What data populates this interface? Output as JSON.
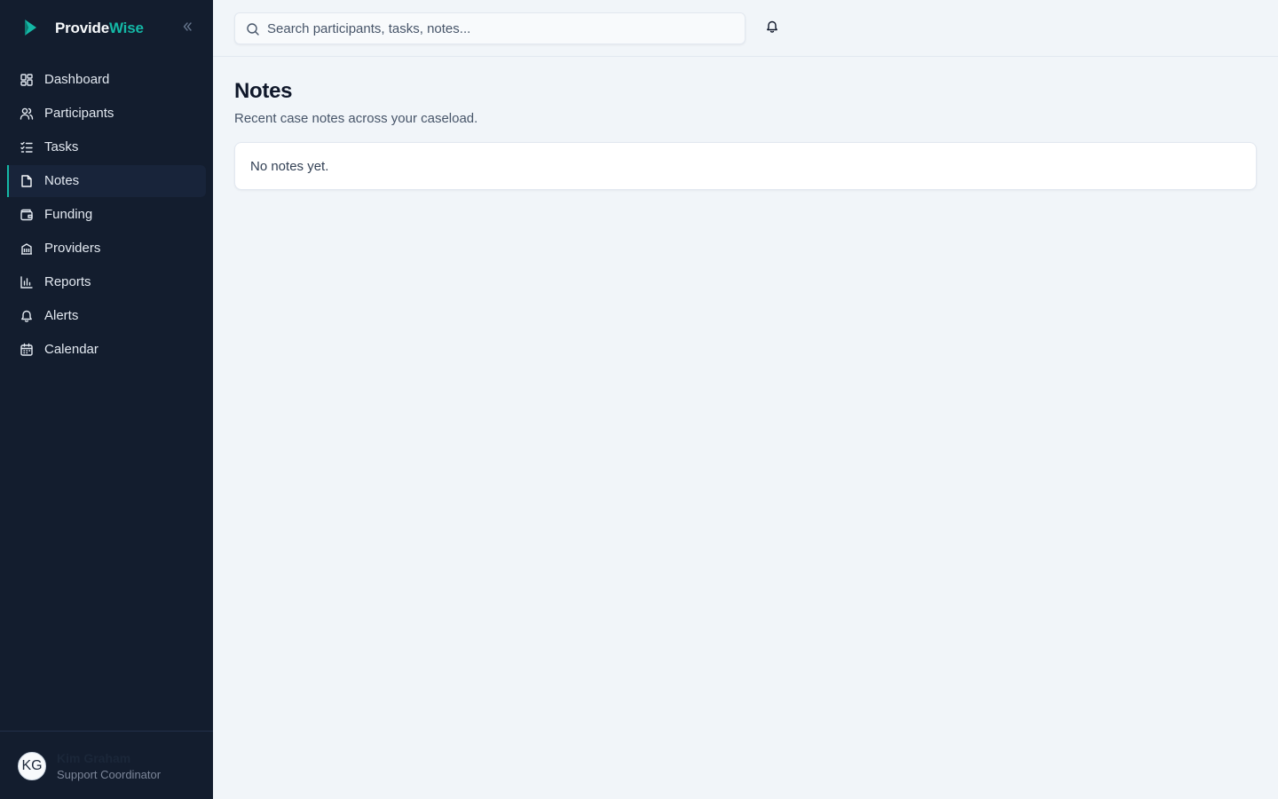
{
  "brand": {
    "name_part1": "Provide",
    "name_part2": "Wise",
    "logo_icon": "chevron-logo-icon",
    "accent_color": "#14b8a6"
  },
  "sidebar": {
    "collapse_icon": "double-chevron-left-icon",
    "items": [
      {
        "label": "Dashboard",
        "icon": "grid-icon",
        "active": false
      },
      {
        "label": "Participants",
        "icon": "users-icon",
        "active": false
      },
      {
        "label": "Tasks",
        "icon": "list-checks-icon",
        "active": false
      },
      {
        "label": "Notes",
        "icon": "file-icon",
        "active": true
      },
      {
        "label": "Funding",
        "icon": "wallet-icon",
        "active": false
      },
      {
        "label": "Providers",
        "icon": "building-icon",
        "active": false
      },
      {
        "label": "Reports",
        "icon": "bar-chart-icon",
        "active": false
      },
      {
        "label": "Alerts",
        "icon": "bell-icon",
        "active": false
      },
      {
        "label": "Calendar",
        "icon": "calendar-icon",
        "active": false
      }
    ]
  },
  "user": {
    "initials": "KG",
    "name": "Kim Graham",
    "role": "Support Coordinator"
  },
  "topbar": {
    "search_placeholder": "Search participants, tasks, notes...",
    "search_value": "",
    "notification_icon": "bell-icon"
  },
  "main": {
    "title": "Notes",
    "subtitle": "Recent case notes across your caseload.",
    "empty_message": "No notes yet."
  }
}
